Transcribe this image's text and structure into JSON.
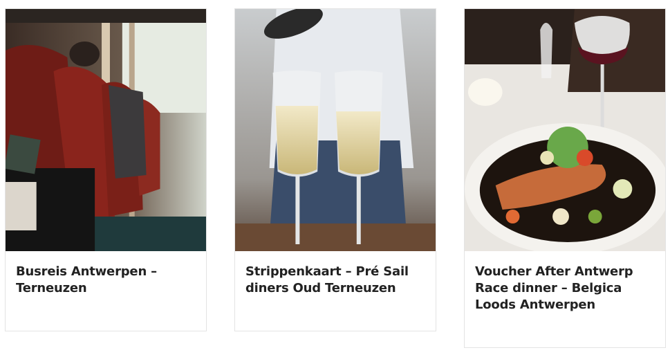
{
  "cards": [
    {
      "title": "Busreis Antwerpen – Terneuzen",
      "image_alt": "bus-interior-photo"
    },
    {
      "title": "Strippenkaart – Pré Sail diners Oud Terneuzen",
      "image_alt": "champagne-glasses-photo"
    },
    {
      "title": "Voucher After Antwerp Race dinner – Belgica Loods Antwerpen",
      "image_alt": "salmon-dish-photo"
    }
  ],
  "colors": {
    "title_text": "#222222",
    "card_border": "#e3e3e3"
  }
}
